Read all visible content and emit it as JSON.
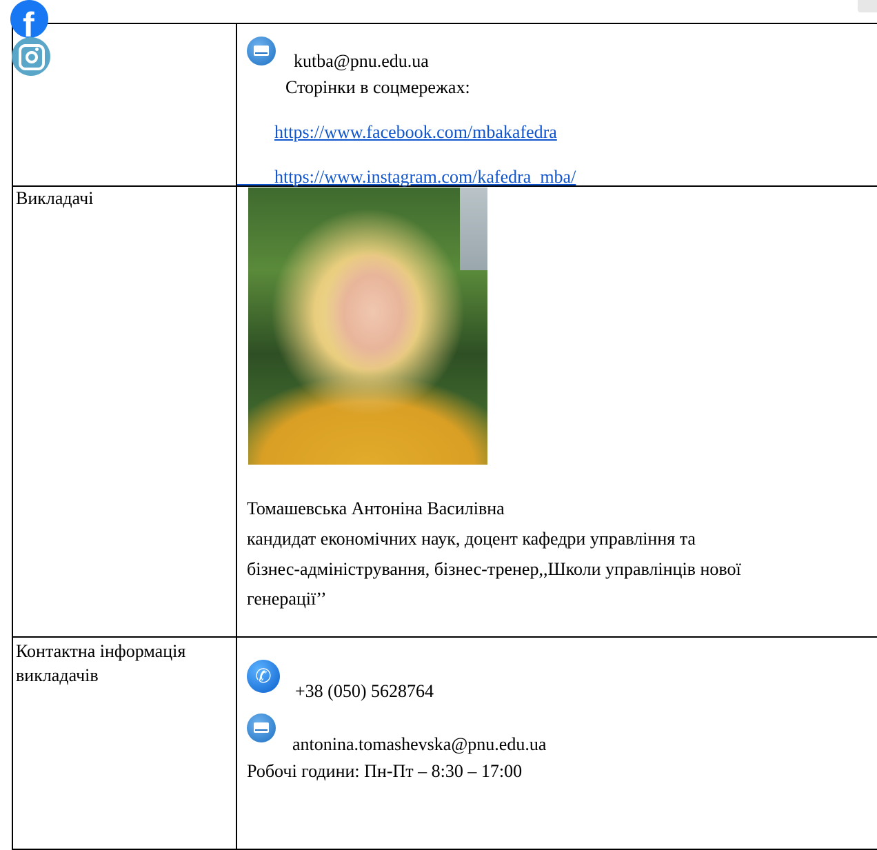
{
  "contact_top": {
    "email": "kutba@pnu.edu.ua",
    "social_heading": "Сторінки в соцмережах:",
    "facebook_url": "https://www.facebook.com/mbakafedra",
    "instagram_url": "https://www.instagram.com/kafedra_mba/",
    "icons": [
      "facebook-icon",
      "instagram-icon",
      "email-icon"
    ]
  },
  "teachers": {
    "label": "Викладачі",
    "name": "Томашевська Антоніна Василівна",
    "position_line1": "кандидат економічних наук, доцент кафедри управління та",
    "position_line2": "бізнес-адміністрування, бізнес-тренер,,Школи управлінців нової",
    "position_line3": "генерації’’"
  },
  "teacher_contacts": {
    "label_line1": "Контактна інформація",
    "label_line2": "викладачів",
    "phone": "+38 (050) 5628764",
    "email": "antonina.tomashevska@pnu.edu.ua",
    "hours": "Робочі години: Пн-Пт – 8:30 – 17:00",
    "icons": [
      "phone-icon",
      "email-icon"
    ]
  },
  "colors": {
    "link": "#1155cc",
    "border": "#000000",
    "facebook": "#1877f2",
    "instagram": "#5aa6c9"
  }
}
